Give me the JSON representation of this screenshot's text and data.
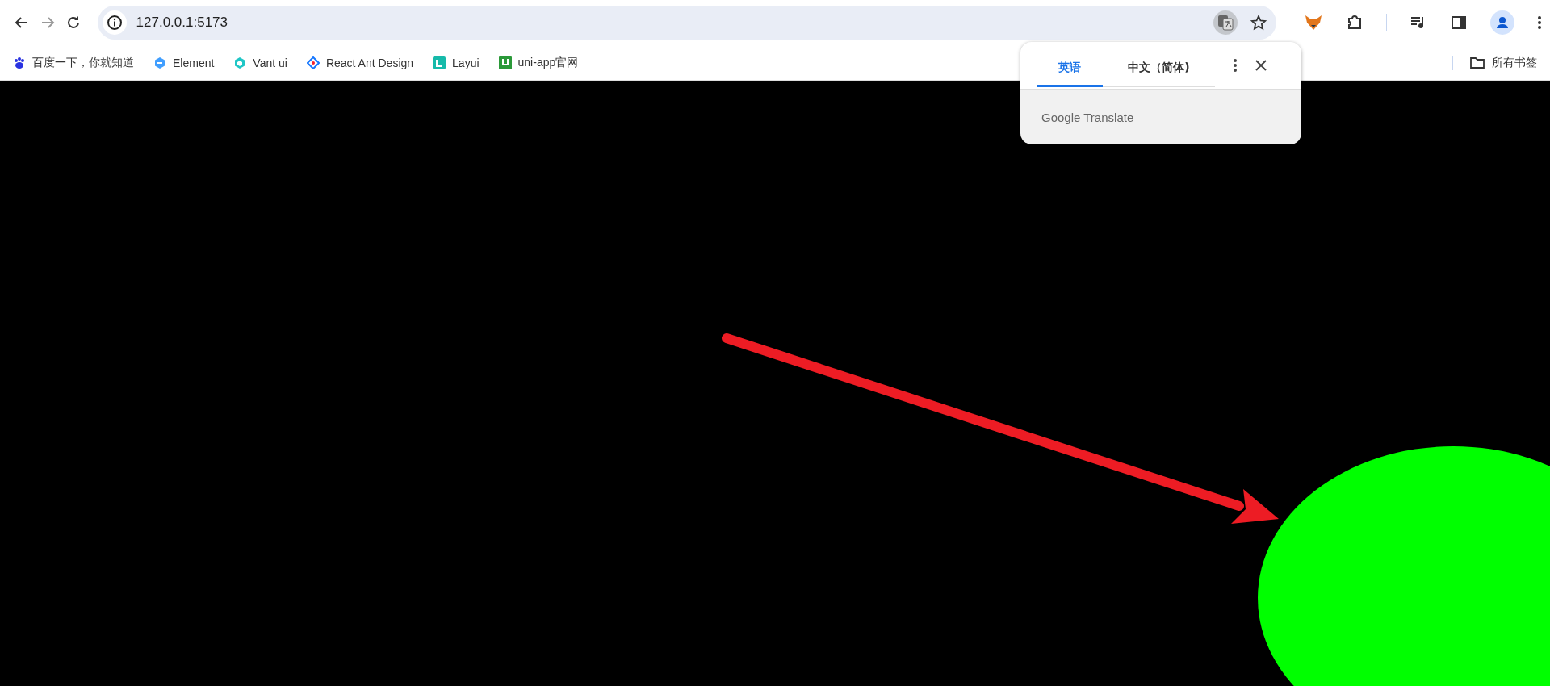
{
  "toolbar": {
    "url": "127.0.0.1:5173"
  },
  "bookmarks": [
    {
      "label": "百度一下，你就知道"
    },
    {
      "label": "Element"
    },
    {
      "label": "Vant ui"
    },
    {
      "label": "React Ant Design"
    },
    {
      "label": "Layui"
    },
    {
      "label": "uni-app官网"
    }
  ],
  "all_bookmarks": "所有书签",
  "translate_popup": {
    "tabs": [
      {
        "label": "英语",
        "selected": true
      },
      {
        "label": "中文（简体)",
        "selected": false
      }
    ],
    "footer": "Google Translate"
  }
}
